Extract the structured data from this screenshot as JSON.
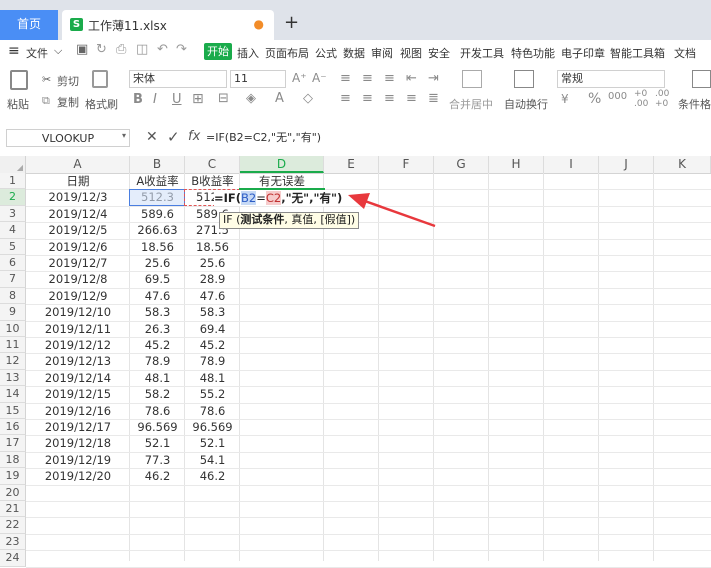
{
  "titlebar": {
    "home_tab": "首页",
    "file_tab": "工作薄11.xlsx",
    "file_icon": "S",
    "unsaved_dot": "●",
    "new_tab": "+"
  },
  "menu": {
    "hamburger": "≡",
    "file": "文件",
    "tabs": [
      "开始",
      "插入",
      "页面布局",
      "公式",
      "数据",
      "审阅",
      "视图",
      "安全",
      "开发工具",
      "特色功能",
      "电子印章",
      "智能工具箱",
      "文档"
    ]
  },
  "ribbon": {
    "paste": "粘贴",
    "cut": "剪切",
    "copy": "复制",
    "format_painter": "格式刷",
    "font_name": "宋体",
    "font_size": "11",
    "merge_center": "合并居中",
    "wrap_text": "自动换行",
    "number_format": "常规",
    "conditional": "条件格式",
    "bold": "B",
    "italic": "I",
    "underline": "U"
  },
  "formula_bar": {
    "name_box": "VLOOKUP",
    "cancel": "✕",
    "confirm": "✓",
    "fx": "fx",
    "formula": "=IF(B2=C2,\"无\",\"有\")"
  },
  "columns": [
    "A",
    "B",
    "C",
    "D",
    "E",
    "F",
    "G",
    "H",
    "I",
    "J",
    "K"
  ],
  "rows": [
    "1",
    "2",
    "3",
    "4",
    "5",
    "6",
    "7",
    "8",
    "9",
    "10",
    "11",
    "12",
    "13",
    "14",
    "15",
    "16",
    "17",
    "18",
    "19",
    "20",
    "21",
    "22",
    "23",
    "24"
  ],
  "headers": {
    "date": "日期",
    "a_rate": "A收益率",
    "b_rate": "B收益率",
    "diff": "有无误差"
  },
  "data": [
    [
      "2019/12/3",
      "512.3",
      "512.3"
    ],
    [
      "2019/12/4",
      "589.6",
      "589.6"
    ],
    [
      "2019/12/5",
      "266.63",
      "271.5"
    ],
    [
      "2019/12/6",
      "18.56",
      "18.56"
    ],
    [
      "2019/12/7",
      "25.6",
      "25.6"
    ],
    [
      "2019/12/8",
      "69.5",
      "28.9"
    ],
    [
      "2019/12/9",
      "47.6",
      "47.6"
    ],
    [
      "2019/12/10",
      "58.3",
      "58.3"
    ],
    [
      "2019/12/11",
      "26.3",
      "69.4"
    ],
    [
      "2019/12/12",
      "45.2",
      "45.2"
    ],
    [
      "2019/12/13",
      "78.9",
      "78.9"
    ],
    [
      "2019/12/14",
      "48.1",
      "48.1"
    ],
    [
      "2019/12/15",
      "58.2",
      "55.2"
    ],
    [
      "2019/12/16",
      "78.6",
      "78.6"
    ],
    [
      "2019/12/17",
      "96.569",
      "96.569"
    ],
    [
      "2019/12/18",
      "52.1",
      "52.1"
    ],
    [
      "2019/12/19",
      "77.3",
      "54.1"
    ],
    [
      "2019/12/20",
      "46.2",
      "46.2"
    ]
  ],
  "edit_cell": {
    "prefix": "=IF(",
    "ref1": "B2",
    "eq": "=",
    "ref2": "C2",
    "suffix": ",\"无\",\"有\")"
  },
  "tooltip": {
    "fn": "IF (",
    "arg1": "测试条件",
    "rest": ", 真值, [假值])"
  },
  "accent": "#1aab4b",
  "arrow_color": "#e8383d"
}
